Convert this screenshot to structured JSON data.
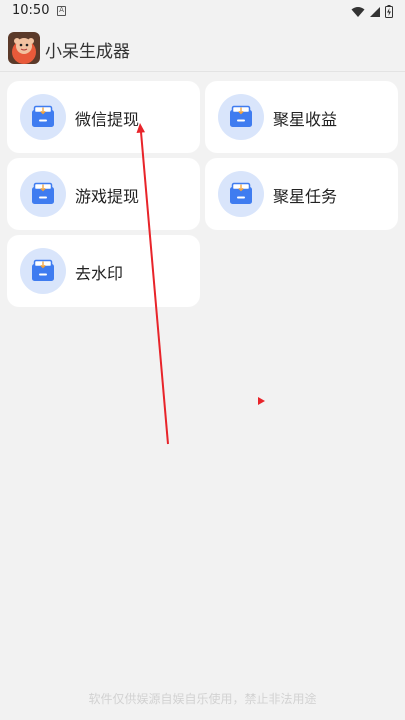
{
  "status_bar": {
    "time": "10:50",
    "sim_letter": "A"
  },
  "app_bar": {
    "title": "小呆生成器"
  },
  "menu": [
    {
      "label": "微信提现"
    },
    {
      "label": "聚星收益"
    },
    {
      "label": "游戏提现"
    },
    {
      "label": "聚星任务"
    },
    {
      "label": "去水印"
    }
  ],
  "footer": {
    "text": "软件仅供娱源自娱自乐使用，禁止非法用途"
  },
  "colors": {
    "background": "#f2f2f2",
    "card": "#ffffff",
    "icon_circle": "#d9e5fb",
    "icon_blue": "#3f7cf0",
    "annotation_red": "#e8242a"
  }
}
